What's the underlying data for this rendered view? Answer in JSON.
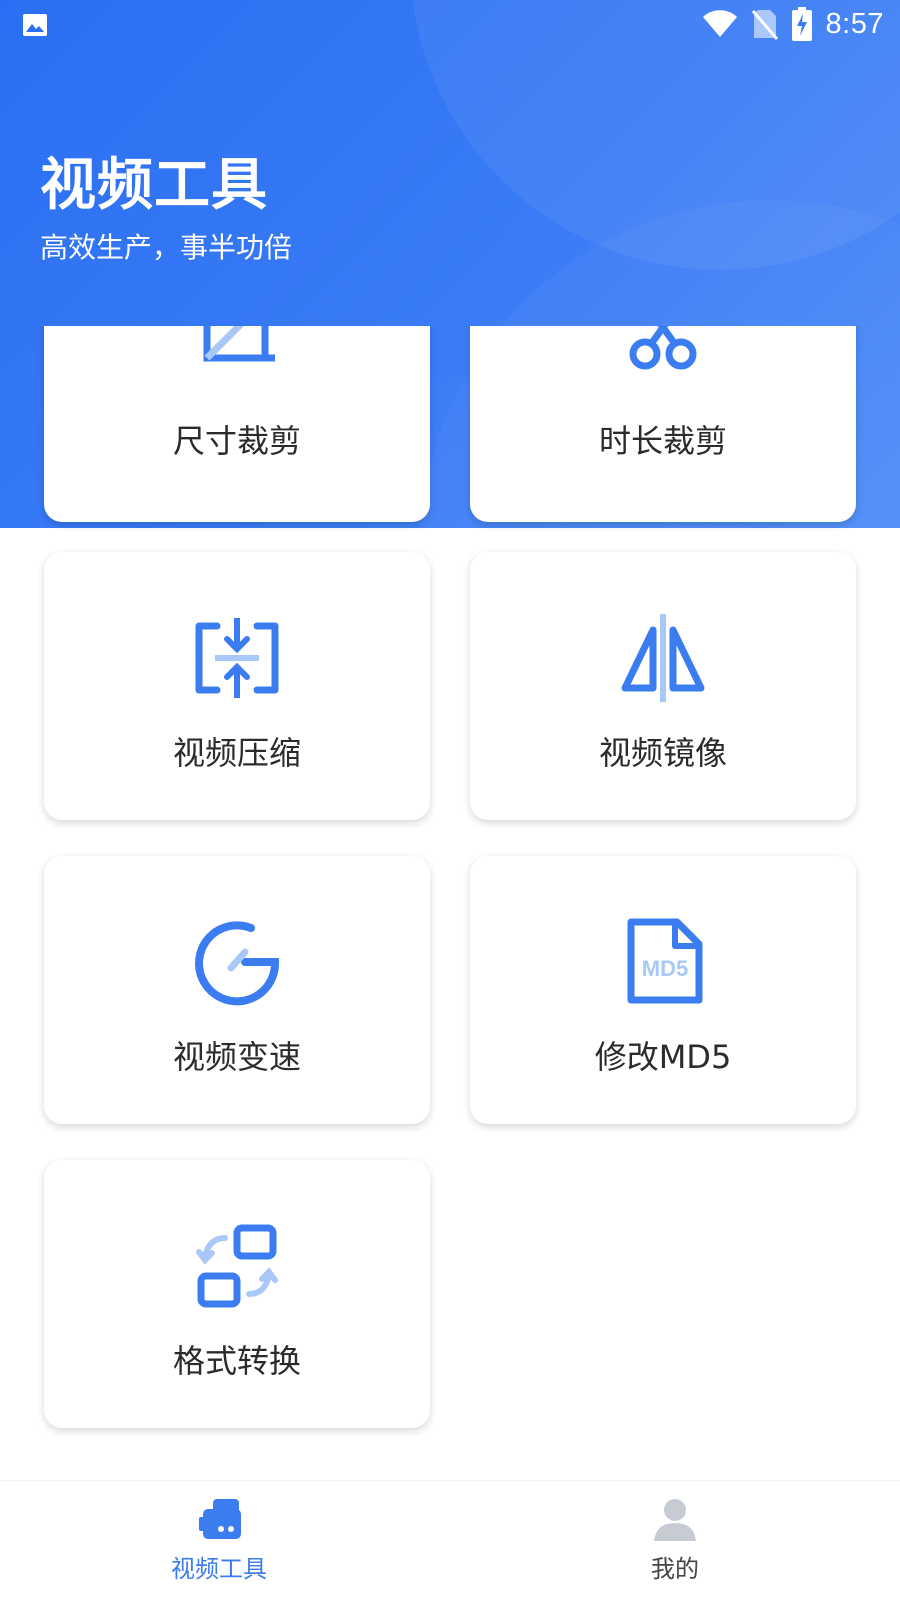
{
  "status_bar": {
    "time": "8:57",
    "icons": [
      "image-icon",
      "wifi-icon",
      "no-sim-icon",
      "battery-charging-icon"
    ]
  },
  "header": {
    "title": "视频工具",
    "subtitle": "高效生产，事半功倍"
  },
  "tools": [
    {
      "label": "尺寸裁剪",
      "icon": "crop-icon"
    },
    {
      "label": "时长裁剪",
      "icon": "scissors-icon"
    },
    {
      "label": "视频压缩",
      "icon": "compress-icon"
    },
    {
      "label": "视频镜像",
      "icon": "mirror-icon"
    },
    {
      "label": "视频变速",
      "icon": "speed-gauge-icon"
    },
    {
      "label": "修改MD5",
      "icon": "md5-file-icon",
      "icon_text": "MD5"
    },
    {
      "label": "格式转换",
      "icon": "format-convert-icon"
    }
  ],
  "bottom_nav": {
    "items": [
      {
        "label": "视频工具",
        "icon": "video-tools-icon",
        "active": true
      },
      {
        "label": "我的",
        "icon": "person-icon",
        "active": false
      }
    ]
  },
  "colors": {
    "header_gradient_start": "#2a6ff3",
    "header_gradient_end": "#4f8df7",
    "icon_blue": "#3b7cf0",
    "icon_light_blue": "#a9c8f8",
    "nav_active": "#3b7cf0",
    "nav_inactive": "#444444"
  }
}
